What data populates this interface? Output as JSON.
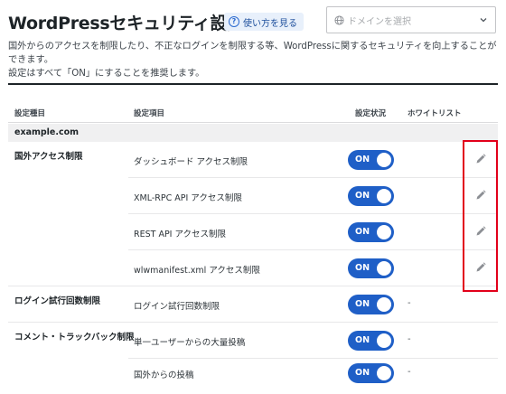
{
  "header": {
    "title": "WordPressセキュリティ設定",
    "help_label": "使い方を見る",
    "domain_select_placeholder": "ドメインを選択"
  },
  "description": {
    "line1": "国外からのアクセスを制限したり、不正なログインを制限する等、WordPressに関するセキュリティを向上することができます。",
    "line2": "設定はすべて「ON」にすることを推奨します。"
  },
  "table": {
    "headers": {
      "category": "設定種目",
      "item": "設定項目",
      "status": "設定状況",
      "whitelist": "ホワイトリスト"
    },
    "domain": "example.com",
    "rows": [
      {
        "category": "国外アクセス制限",
        "item": "ダッシュボード アクセス制限",
        "status": "ON",
        "whitelist": ""
      },
      {
        "category": "",
        "item": "XML-RPC API アクセス制限",
        "status": "ON",
        "whitelist": ""
      },
      {
        "category": "",
        "item": "REST API アクセス制限",
        "status": "ON",
        "whitelist": ""
      },
      {
        "category": "",
        "item": "wlwmanifest.xml アクセス制限",
        "status": "ON",
        "whitelist": ""
      },
      {
        "category": "ログイン試行回数制限",
        "item": "ログイン試行回数制限",
        "status": "ON",
        "whitelist": "-"
      },
      {
        "category": "コメント・トラックバック制限",
        "item": "単一ユーザーからの大量投稿",
        "status": "ON",
        "whitelist": "-"
      },
      {
        "category": "",
        "item": "国外からの投稿",
        "status": "ON",
        "whitelist": "-"
      }
    ]
  },
  "colors": {
    "toggle_on": "#1f5fc7",
    "highlight": "#e2001a",
    "help_bg": "#e8f0fb"
  },
  "icons": {
    "help": "question-circle-icon",
    "domain": "globe-icon",
    "dropdown": "chevron-down-icon",
    "edit": "pencil-icon"
  }
}
